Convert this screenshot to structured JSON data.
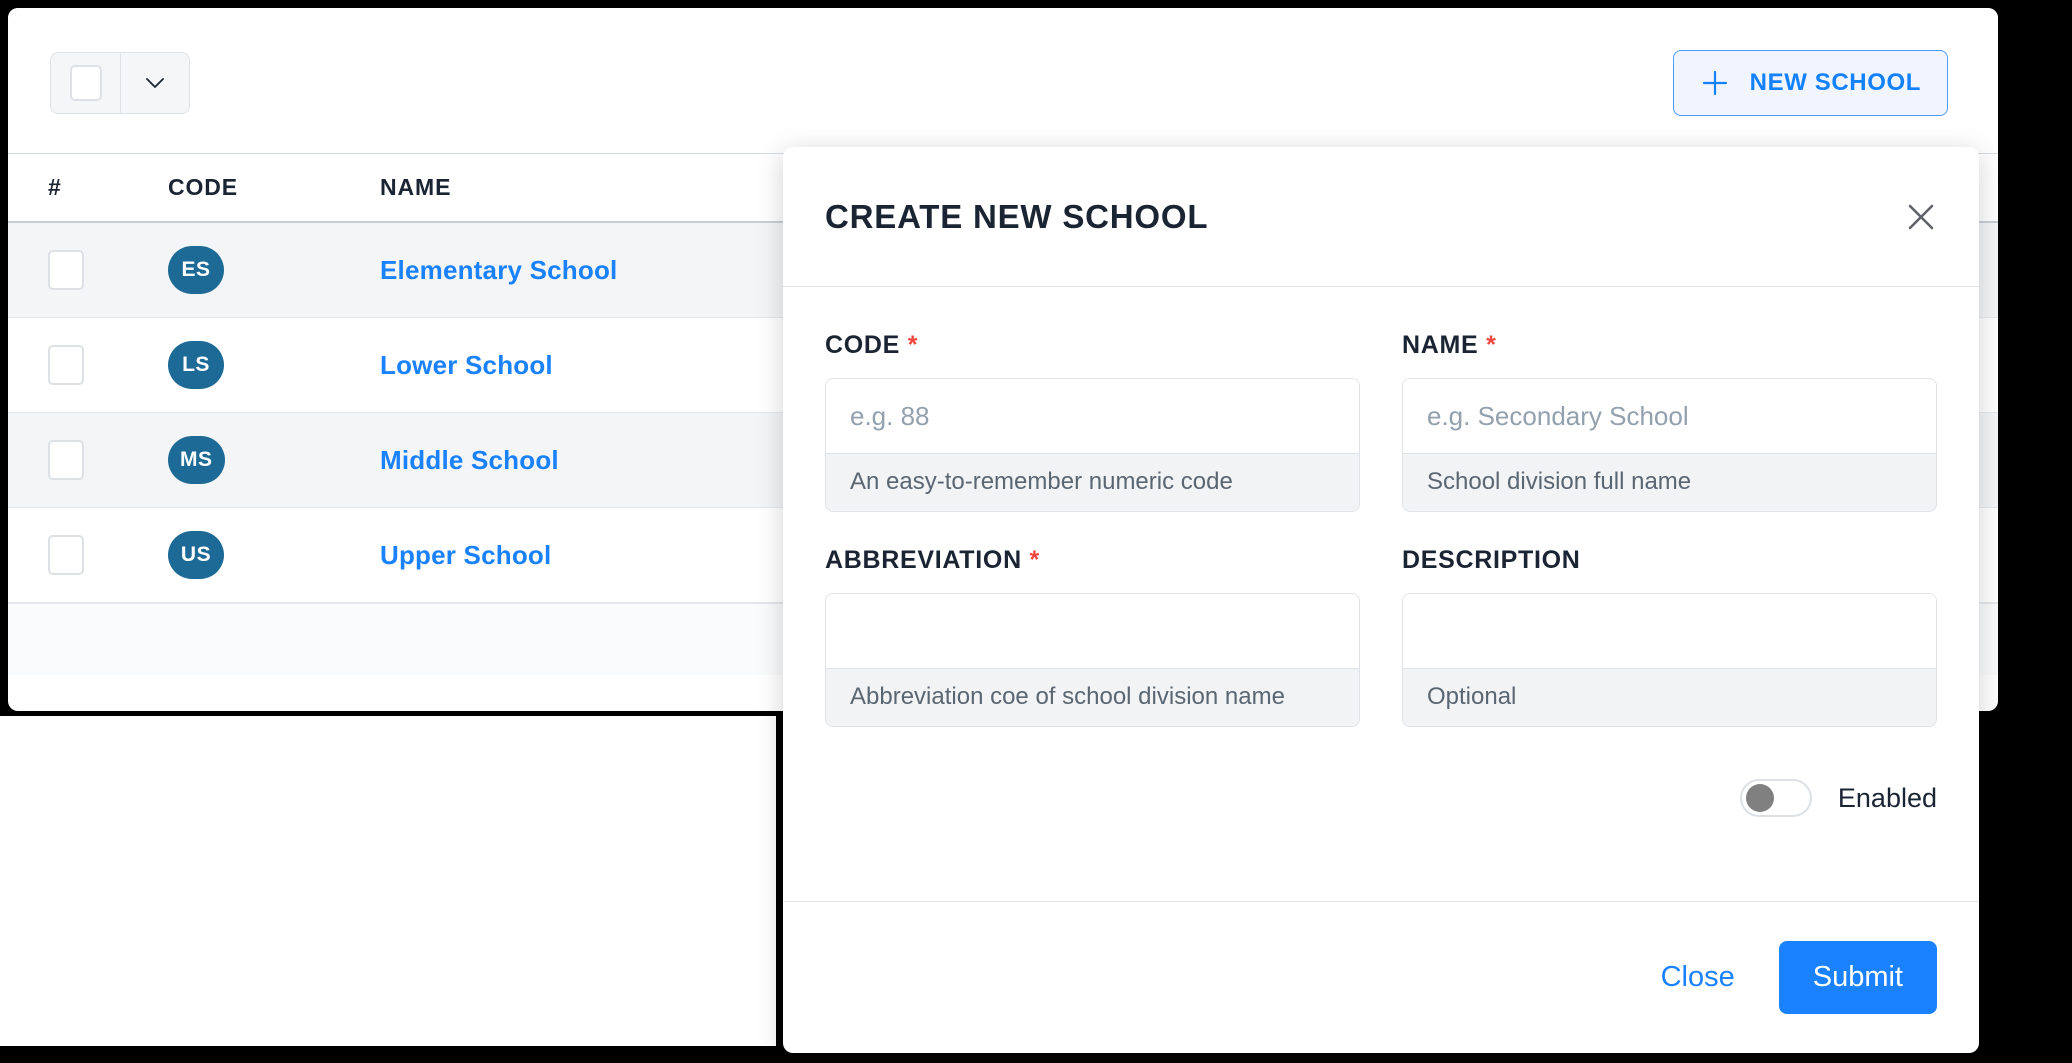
{
  "colors": {
    "accent_blue": "#1a82ff",
    "badge_teal": "#1d6a96",
    "required_red": "#f1453d",
    "text_dark": "#1b2433",
    "help_bg": "#f1f3f5",
    "row_alt_bg": "#f4f5f7",
    "backdrop": "#000000"
  },
  "toolbar": {
    "select_all_icon": "checkbox-icon",
    "dropdown_icon": "chevron-down-icon",
    "new_school_label": "NEW SCHOOL",
    "new_school_icon": "plus-icon"
  },
  "table": {
    "columns": [
      "#",
      "CODE",
      "NAME",
      ""
    ],
    "row_action_icon": "hamburger-menu-icon",
    "rows": [
      {
        "code": "ES",
        "name": "Elementary School",
        "checked": false
      },
      {
        "code": "LS",
        "name": "Lower School",
        "checked": false
      },
      {
        "code": "MS",
        "name": "Middle School",
        "checked": false
      },
      {
        "code": "US",
        "name": "Upper School",
        "checked": false
      }
    ]
  },
  "modal": {
    "title": "CREATE NEW SCHOOL",
    "close_icon": "close-icon",
    "fields": {
      "code": {
        "label": "CODE",
        "required_mark": "*",
        "value": "",
        "placeholder": "e.g. 88",
        "help": "An easy-to-remember numeric code"
      },
      "name": {
        "label": "NAME",
        "required_mark": "*",
        "value": "",
        "placeholder": "e.g. Secondary School",
        "help": "School division full name"
      },
      "abbreviation": {
        "label": "ABBREVIATION",
        "required_mark": "*",
        "value": "",
        "placeholder": "",
        "help": "Abbreviation coe of school division name"
      },
      "description": {
        "label": "DESCRIPTION",
        "required_mark": "",
        "value": "",
        "placeholder": "",
        "help": "Optional"
      }
    },
    "toggle": {
      "label": "Enabled",
      "on": false
    },
    "footer": {
      "close_label": "Close",
      "submit_label": "Submit"
    }
  }
}
